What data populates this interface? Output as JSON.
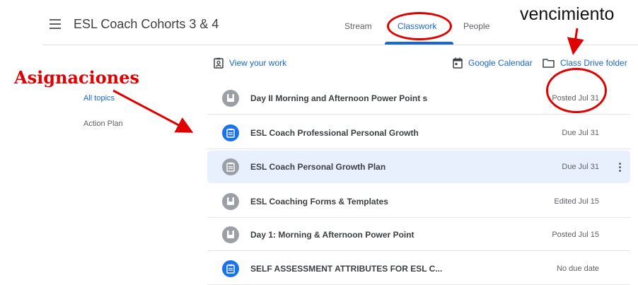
{
  "header": {
    "class_title": "ESL Coach Cohorts 3 & 4",
    "tabs": [
      {
        "label": "Stream",
        "active": false
      },
      {
        "label": "Classwork",
        "active": true
      },
      {
        "label": "People",
        "active": false
      }
    ],
    "accent_color": "#1967d2"
  },
  "annotations": {
    "left_label": "Asignaciones",
    "right_label": "vencimiento",
    "color": "#e00000"
  },
  "sidebar": {
    "items": [
      {
        "label": "All topics",
        "active": true
      },
      {
        "label": "Action Plan",
        "active": false
      }
    ]
  },
  "actions": {
    "view_work": "View your work",
    "google_calendar": "Google Calendar",
    "drive_folder": "Class Drive folder"
  },
  "classwork": [
    {
      "title": "Day II Morning and Afternoon Power Point s",
      "status": "Posted Jul 31",
      "icon": "material-icon",
      "icon_color": "#9aa0a6"
    },
    {
      "title": "ESL Coach Professional Personal Growth",
      "status": "Due Jul 31",
      "icon": "assignment-icon",
      "icon_color": "#1a73e8"
    },
    {
      "title": "ESL Coach Personal Growth Plan",
      "status": "Due Jul 31",
      "icon": "assignment-icon",
      "icon_color": "#9aa0a6",
      "selected": true
    },
    {
      "title": "ESL Coaching Forms & Templates",
      "status": "Edited Jul 15",
      "icon": "material-icon",
      "icon_color": "#9aa0a6"
    },
    {
      "title": "Day 1: Morning & Afternoon Power Point",
      "status": "Posted Jul 15",
      "icon": "material-icon",
      "icon_color": "#9aa0a6"
    },
    {
      "title": "SELF ASSESSMENT ATTRIBUTES FOR ESL C...",
      "status": "No due date",
      "icon": "assignment-icon",
      "icon_color": "#1a73e8"
    }
  ]
}
